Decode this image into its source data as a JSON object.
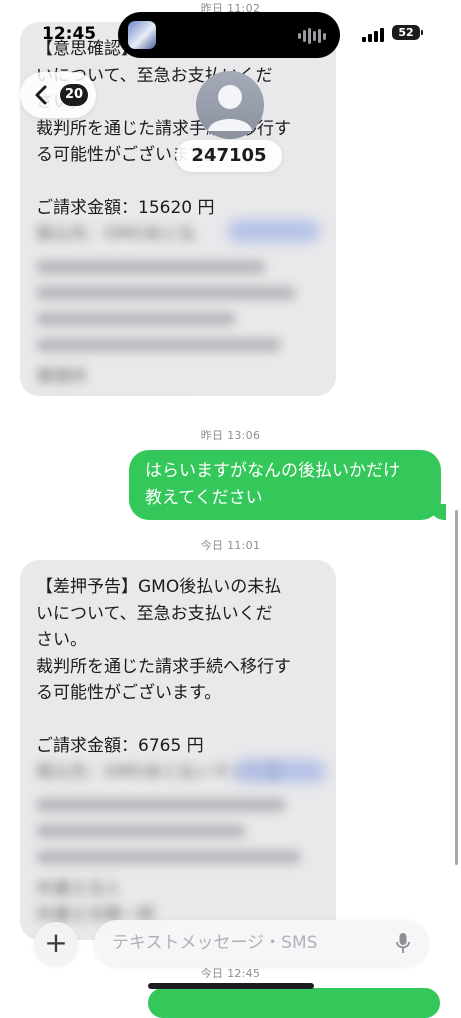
{
  "status_bar": {
    "time": "12:45",
    "battery": "52"
  },
  "nav": {
    "back_count": "20",
    "contact_name": "247105"
  },
  "thread": {
    "top_stamp": "昨日 11:02",
    "msg1": {
      "lines": [
        "【意思確認】GMO後払いの未払",
        "いについて、至急お支払いくだ",
        "さい。",
        "裁判所を通じた請求手続へ移行す",
        "る可能性がございます。"
      ],
      "amount": "ご請求金額：15620 円",
      "partial": "振込先：GMOあと払",
      "office": "事務所"
    },
    "stamp2": "昨日 13:06",
    "msg2": {
      "lines": [
        "はらいますがなんの後払いかだけ",
        "教えてください"
      ]
    },
    "stamp3": "今日 11:01",
    "msg3": {
      "lines": [
        "【差押予告】GMO後払いの未払",
        "いについて、至急お支払いくだ",
        "さい。",
        "裁判所を通じた請求手続へ移行す",
        "る可能性がございます。"
      ],
      "amount": "ご請求金額：6765 円",
      "partial": "振込先：GMOあと払いネット銀",
      "office": "弁護士法人",
      "signer": "弁護士光輝一郎"
    },
    "stamp4": "今日 12:45"
  },
  "composer": {
    "placeholder": "テキストメッセージ・SMS"
  },
  "colors": {
    "outgoing": "#34c759",
    "incoming": "#e9e9eb"
  },
  "icons": [
    "chevron-left-icon",
    "contact-avatar-icon",
    "plus-icon",
    "microphone-icon",
    "signal-icon",
    "battery-icon",
    "soundwave-icon"
  ]
}
